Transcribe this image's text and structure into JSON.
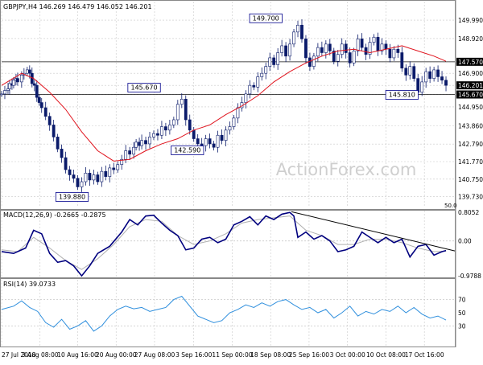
{
  "main_header": "GBPJPY,H4  146.269 146.479 146.052 146.201",
  "watermark": "ActionForex.com",
  "scale_label": "50.0",
  "colors": {
    "candles": "#0a1a6a",
    "ma": "#e0141e",
    "macd": "#00007f",
    "signal": "#b0b0b0",
    "rsi": "#2f8fdd",
    "trendline": "#000000",
    "grid": "#c8c8c8",
    "hline": "#111111",
    "price_tag": "#00008b"
  },
  "chart_data": [
    {
      "type": "candlestick",
      "title": "GBPJPY,H4  146.269 146.479 146.052 146.201",
      "ylim": [
        139.2,
        150.6
      ],
      "y_ticks": [
        "149.990",
        "148.920",
        "147.570",
        "146.900",
        "146.201",
        "145.670",
        "144.950",
        "143.860",
        "142.790",
        "141.770",
        "140.750",
        "139.730"
      ],
      "x_ticks": [
        "27 Jul 2018",
        "3 Aug 08:00",
        "10 Aug 16:00",
        "20 Aug 00:00",
        "27 Aug 08:00",
        "3 Sep 16:00",
        "11 Sep 00:00",
        "18 Sep 08:00",
        "25 Sep 16:00",
        "3 Oct 00:00",
        "10 Oct 08:00",
        "17 Oct 16:00"
      ],
      "current_price": "146.201",
      "horizontal_levels": [
        147.57,
        145.67
      ],
      "annotations": [
        "149.700",
        "145.670",
        "142.590",
        "139.880",
        "145.810"
      ],
      "series": [
        {
          "name": "Price",
          "x": [
            0,
            4,
            8,
            10,
            13,
            15,
            18,
            20,
            25,
            28,
            32,
            35,
            38,
            41,
            44,
            47,
            50,
            55,
            60,
            65,
            70,
            75,
            80,
            85,
            90,
            95,
            100,
            105,
            110,
            115,
            120,
            125,
            130,
            135,
            140,
            145,
            150,
            155,
            160,
            165,
            168,
            172,
            175,
            180,
            185,
            190,
            195,
            200,
            205,
            210,
            215,
            220,
            225,
            230,
            235,
            240,
            245,
            250,
            255,
            260,
            265,
            270,
            275,
            280,
            285,
            290,
            295,
            300,
            305,
            310,
            315,
            320,
            325,
            330,
            335,
            340,
            345,
            350,
            355,
            360,
            365,
            370,
            375,
            380,
            385,
            390,
            395,
            400,
            405,
            410,
            415,
            420,
            425,
            430,
            435,
            440,
            445,
            450,
            455,
            460,
            465,
            470,
            475,
            480,
            485,
            490,
            495,
            500,
            505,
            510,
            515,
            520,
            525,
            530,
            535,
            540,
            545,
            550,
            555
          ],
          "y": [
            145.7,
            145.9,
            146.0,
            146.3,
            146.2,
            146.5,
            146.6,
            146.4,
            146.8,
            146.9,
            147.1,
            146.9,
            146.3,
            146.2,
            145.5,
            145.2,
            144.9,
            144.4,
            143.9,
            143.2,
            142.5,
            142.0,
            141.3,
            141.0,
            140.8,
            140.3,
            140.6,
            141.1,
            140.7,
            141.0,
            140.6,
            141.2,
            140.9,
            141.4,
            141.3,
            141.6,
            141.9,
            142.4,
            142.2,
            142.6,
            142.9,
            142.7,
            143.0,
            142.8,
            143.2,
            143.4,
            143.3,
            143.8,
            143.6,
            143.9,
            144.2,
            145.1,
            145.4,
            144.2,
            143.6,
            143.1,
            142.8,
            142.7,
            143.1,
            142.8,
            142.6,
            143.3,
            143.0,
            143.6,
            143.8,
            144.3,
            144.9,
            145.2,
            145.7,
            146.2,
            146.1,
            146.7,
            146.9,
            147.3,
            147.8,
            147.4,
            148.1,
            148.5,
            147.9,
            148.6,
            149.3,
            149.7,
            148.9,
            147.8,
            147.3,
            147.9,
            148.4,
            148.1,
            148.6,
            148.2,
            147.6,
            148.0,
            148.6,
            148.1,
            147.5,
            148.2,
            148.9,
            148.4,
            148.0,
            148.7,
            149.0,
            148.2,
            148.6,
            148.3,
            147.8,
            148.3,
            148.1,
            147.2,
            146.8,
            147.3,
            146.6,
            145.8,
            146.4,
            147.0,
            146.6,
            147.1,
            146.7,
            146.5,
            146.2
          ]
        },
        {
          "name": "Moving Average",
          "x": [
            0,
            25,
            40,
            60,
            80,
            100,
            120,
            140,
            160,
            180,
            200,
            220,
            240,
            260,
            280,
            300,
            320,
            340,
            360,
            380,
            400,
            420,
            440,
            460,
            480,
            500,
            520,
            540,
            555
          ],
          "y": [
            146.2,
            146.9,
            146.6,
            145.8,
            144.8,
            143.5,
            142.4,
            141.8,
            141.9,
            142.4,
            142.8,
            143.1,
            143.6,
            143.9,
            144.5,
            145.0,
            145.6,
            146.4,
            147.0,
            147.5,
            147.9,
            148.2,
            148.3,
            148.1,
            148.3,
            148.5,
            148.2,
            147.9,
            147.6
          ]
        }
      ]
    },
    {
      "type": "line",
      "title": "MACD(12,26,9) -0.2665 -0.2875",
      "ylim": [
        -1.0,
        0.85
      ],
      "y_ticks": [
        "0.8052",
        "0.00",
        "-0.9788"
      ],
      "series": [
        {
          "name": "MACD",
          "x": [
            0,
            15,
            30,
            40,
            50,
            60,
            70,
            80,
            90,
            100,
            110,
            120,
            135,
            150,
            160,
            170,
            180,
            190,
            200,
            210,
            220,
            230,
            240,
            250,
            260,
            270,
            280,
            290,
            300,
            310,
            320,
            330,
            340,
            350,
            360,
            365,
            370,
            380,
            390,
            400,
            410,
            420,
            430,
            440,
            450,
            460,
            470,
            480,
            490,
            500,
            510,
            520,
            530,
            540,
            545,
            550,
            555
          ],
          "y": [
            -0.3,
            -0.35,
            -0.2,
            0.3,
            0.2,
            -0.35,
            -0.6,
            -0.55,
            -0.7,
            -0.98,
            -0.7,
            -0.35,
            -0.15,
            0.25,
            0.6,
            0.45,
            0.7,
            0.72,
            0.5,
            0.3,
            0.15,
            -0.25,
            -0.2,
            0.05,
            0.1,
            -0.05,
            0.05,
            0.45,
            0.55,
            0.68,
            0.45,
            0.7,
            0.6,
            0.75,
            0.8,
            0.7,
            0.1,
            0.25,
            0.05,
            0.15,
            0.0,
            -0.3,
            -0.25,
            -0.15,
            0.25,
            0.1,
            -0.05,
            0.1,
            -0.05,
            0.05,
            -0.45,
            -0.15,
            -0.1,
            -0.4,
            -0.35,
            -0.3,
            -0.27
          ]
        },
        {
          "name": "Signal",
          "x": [
            0,
            20,
            40,
            60,
            80,
            100,
            120,
            140,
            160,
            180,
            200,
            220,
            240,
            260,
            280,
            300,
            320,
            340,
            360,
            380,
            400,
            420,
            440,
            460,
            480,
            500,
            520,
            540,
            555
          ],
          "y": [
            -0.25,
            -0.3,
            0.1,
            -0.2,
            -0.55,
            -0.8,
            -0.5,
            -0.1,
            0.4,
            0.6,
            0.55,
            0.15,
            -0.1,
            0.0,
            0.2,
            0.5,
            0.6,
            0.65,
            0.7,
            0.3,
            0.15,
            -0.1,
            -0.1,
            0.05,
            0.05,
            -0.05,
            -0.2,
            -0.3,
            -0.29
          ]
        },
        {
          "name": "Trendline",
          "x": [
            362,
            572
          ],
          "y": [
            0.82,
            -0.28
          ]
        }
      ]
    },
    {
      "type": "line",
      "title": "RSI(14) 39.0733",
      "ylim": [
        0,
        100
      ],
      "y_ticks": [
        "70",
        "50",
        "30"
      ],
      "series": [
        {
          "name": "RSI",
          "x": [
            0,
            15,
            25,
            35,
            45,
            55,
            65,
            75,
            85,
            95,
            105,
            115,
            125,
            135,
            145,
            155,
            165,
            175,
            185,
            195,
            205,
            215,
            225,
            235,
            245,
            255,
            265,
            275,
            285,
            295,
            305,
            315,
            325,
            335,
            345,
            355,
            365,
            375,
            385,
            395,
            405,
            415,
            425,
            435,
            445,
            455,
            465,
            475,
            485,
            495,
            505,
            515,
            525,
            535,
            545,
            555
          ],
          "y": [
            55,
            60,
            68,
            58,
            52,
            35,
            28,
            40,
            25,
            30,
            38,
            22,
            30,
            45,
            55,
            60,
            56,
            58,
            52,
            55,
            58,
            70,
            75,
            60,
            45,
            40,
            35,
            38,
            50,
            55,
            62,
            58,
            65,
            60,
            67,
            70,
            62,
            55,
            58,
            50,
            55,
            42,
            50,
            60,
            45,
            52,
            48,
            55,
            52,
            60,
            50,
            58,
            48,
            42,
            45,
            39
          ]
        }
      ]
    }
  ]
}
